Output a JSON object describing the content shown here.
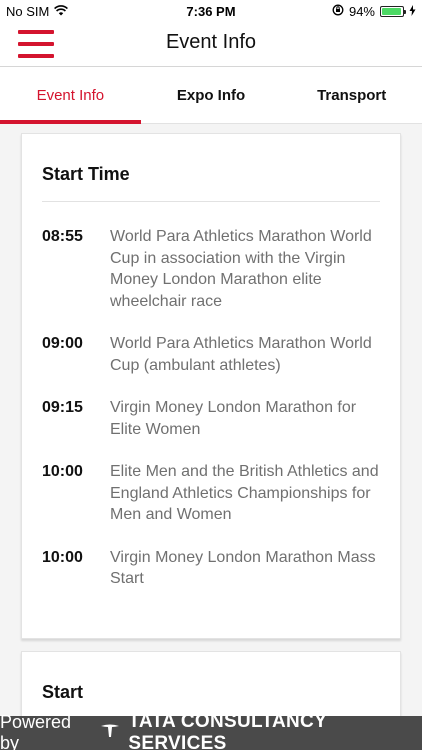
{
  "status_bar": {
    "carrier": "No SIM",
    "time": "7:36 PM",
    "battery_percent": "94%",
    "battery_level": 0.94
  },
  "header": {
    "title": "Event Info"
  },
  "tabs": [
    {
      "label": "Event Info",
      "active": true
    },
    {
      "label": "Expo Info",
      "active": false
    },
    {
      "label": "Transport",
      "active": false
    }
  ],
  "start_time_card": {
    "title": "Start Time",
    "items": [
      {
        "time": "08:55",
        "description": "World Para Athletics Marathon World Cup in association with the Virgin Money London Marathon elite wheelchair race"
      },
      {
        "time": "09:00",
        "description": "World Para Athletics Marathon World Cup (ambulant athletes)"
      },
      {
        "time": "09:15",
        "description": "Virgin Money London Marathon for Elite Women"
      },
      {
        "time": "10:00",
        "description": "Elite Men and the British Athletics and England Athletics Championships for Men and Women"
      },
      {
        "time": "10:00",
        "description": "Virgin Money London Marathon Mass Start"
      }
    ]
  },
  "start_card": {
    "title": "Start"
  },
  "footer": {
    "powered_by": "Powered by",
    "brand": "TATA CONSULTANCY SERVICES"
  },
  "colors": {
    "accent": "#d4142e",
    "footer_bg": "#4a4a4a",
    "battery": "#4cd964"
  }
}
